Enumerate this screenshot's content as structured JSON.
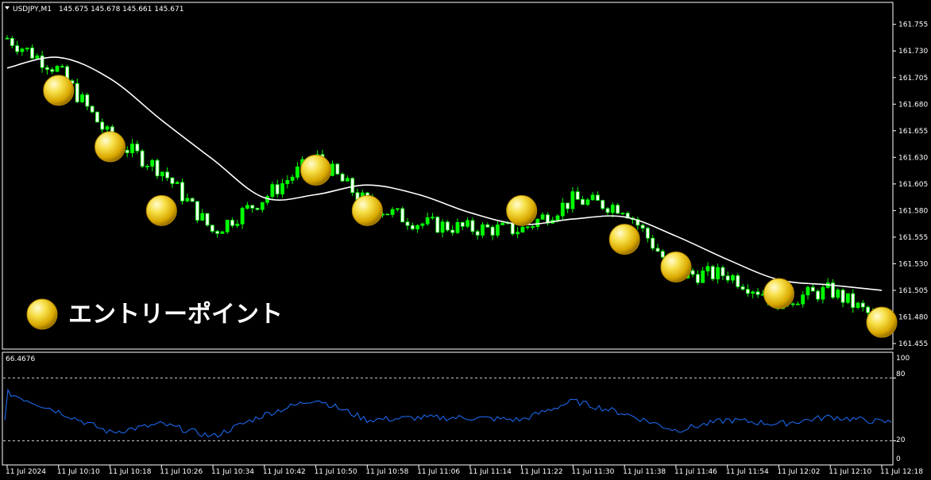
{
  "header": {
    "symbol": "USDJPY,M1",
    "ohlc": "145.675 145.678 145.661 145.671"
  },
  "legend": {
    "label": "エントリーポイント"
  },
  "indicator": {
    "value_label": "66.4676",
    "ticks": [
      "100",
      "80",
      "20",
      "0"
    ]
  },
  "colors": {
    "background": "#000000",
    "bull_candle": "#00ff00",
    "bear_candle": "#ffffff",
    "candle_outline": "#00ff00",
    "ma_line": "#ffffff",
    "rsi_line": "#1e6fff",
    "coin_gold": "#f2c200"
  },
  "chart_data": {
    "type": "candlestick",
    "symbol": "USDJPY",
    "timeframe": "M1",
    "ylim": [
      161.455,
      161.76
    ],
    "y_ticks": [
      "161.755",
      "161.730",
      "161.705",
      "161.680",
      "161.655",
      "161.630",
      "161.605",
      "161.580",
      "161.555",
      "161.530",
      "161.505",
      "161.480",
      "161.455"
    ],
    "x_ticks": [
      "11 Jul 2024",
      "11 Jul 10:10",
      "11 Jul 10:18",
      "11 Jul 10:26",
      "11 Jul 10:34",
      "11 Jul 10:42",
      "11 Jul 10:50",
      "11 Jul 10:58",
      "11 Jul 11:06",
      "11 Jul 11:14",
      "11 Jul 11:22",
      "11 Jul 11:30",
      "11 Jul 11:38",
      "11 Jul 11:46",
      "11 Jul 11:54",
      "11 Jul 12:02",
      "11 Jul 12:10",
      "11 Jul 12:18"
    ],
    "close_path": [
      [
        "11 Jul 2024",
        161.742
      ],
      [
        "11 Jul 10:10",
        161.712
      ],
      [
        "11 Jul 10:18",
        161.648
      ],
      [
        "11 Jul 10:26",
        161.618
      ],
      [
        "11 Jul 10:34",
        161.56
      ],
      [
        "11 Jul 10:42",
        161.592
      ],
      [
        "11 Jul 10:50",
        161.63
      ],
      [
        "11 Jul 10:58",
        161.586
      ],
      [
        "11 Jul 11:06",
        161.568
      ],
      [
        "11 Jul 11:14",
        161.563
      ],
      [
        "11 Jul 11:22",
        161.562
      ],
      [
        "11 Jul 11:30",
        161.59
      ],
      [
        "11 Jul 11:38",
        161.583
      ],
      [
        "11 Jul 11:46",
        161.52
      ],
      [
        "11 Jul 11:54",
        161.52
      ],
      [
        "11 Jul 12:02",
        161.495
      ],
      [
        "11 Jul 12:10",
        161.505
      ],
      [
        "11 Jul 12:18",
        161.475
      ]
    ],
    "moving_average": [
      [
        "11 Jul 2024",
        161.714
      ],
      [
        "11 Jul 10:10",
        161.724
      ],
      [
        "11 Jul 10:18",
        161.704
      ],
      [
        "11 Jul 10:26",
        161.665
      ],
      [
        "11 Jul 10:34",
        161.628
      ],
      [
        "11 Jul 10:42",
        161.592
      ],
      [
        "11 Jul 10:50",
        161.595
      ],
      [
        "11 Jul 10:58",
        161.604
      ],
      [
        "11 Jul 11:06",
        161.595
      ],
      [
        "11 Jul 11:14",
        161.578
      ],
      [
        "11 Jul 11:22",
        161.567
      ],
      [
        "11 Jul 11:30",
        161.572
      ],
      [
        "11 Jul 11:38",
        161.574
      ],
      [
        "11 Jul 11:46",
        161.556
      ],
      [
        "11 Jul 11:54",
        161.534
      ],
      [
        "11 Jul 12:02",
        161.515
      ],
      [
        "11 Jul 12:10",
        161.51
      ],
      [
        "11 Jul 12:18",
        161.505
      ]
    ],
    "entry_points": [
      [
        "11 Jul 10:10",
        161.693
      ],
      [
        "11 Jul 10:18",
        161.64
      ],
      [
        "11 Jul 10:26",
        161.58
      ],
      [
        "11 Jul 10:50",
        161.618
      ],
      [
        "11 Jul 10:58",
        161.58
      ],
      [
        "11 Jul 11:22",
        161.58
      ],
      [
        "11 Jul 11:38",
        161.553
      ],
      [
        "11 Jul 11:46",
        161.527
      ],
      [
        "11 Jul 12:02",
        161.502
      ],
      [
        "11 Jul 12:18",
        161.475
      ]
    ],
    "rsi": {
      "ylim": [
        0,
        100
      ],
      "levels": [
        80,
        20
      ],
      "values": [
        [
          "11 Jul 2024",
          66
        ],
        [
          "11 Jul 10:10",
          48
        ],
        [
          "11 Jul 10:18",
          28
        ],
        [
          "11 Jul 10:26",
          36
        ],
        [
          "11 Jul 10:34",
          24
        ],
        [
          "11 Jul 10:42",
          45
        ],
        [
          "11 Jul 10:50",
          60
        ],
        [
          "11 Jul 10:58",
          40
        ],
        [
          "11 Jul 11:06",
          42
        ],
        [
          "11 Jul 11:14",
          42
        ],
        [
          "11 Jul 11:22",
          40
        ],
        [
          "11 Jul 11:30",
          58
        ],
        [
          "11 Jul 11:38",
          46
        ],
        [
          "11 Jul 11:46",
          30
        ],
        [
          "11 Jul 11:54",
          40
        ],
        [
          "11 Jul 12:02",
          36
        ],
        [
          "11 Jul 12:10",
          43
        ],
        [
          "11 Jul 12:18",
          38
        ]
      ]
    }
  }
}
